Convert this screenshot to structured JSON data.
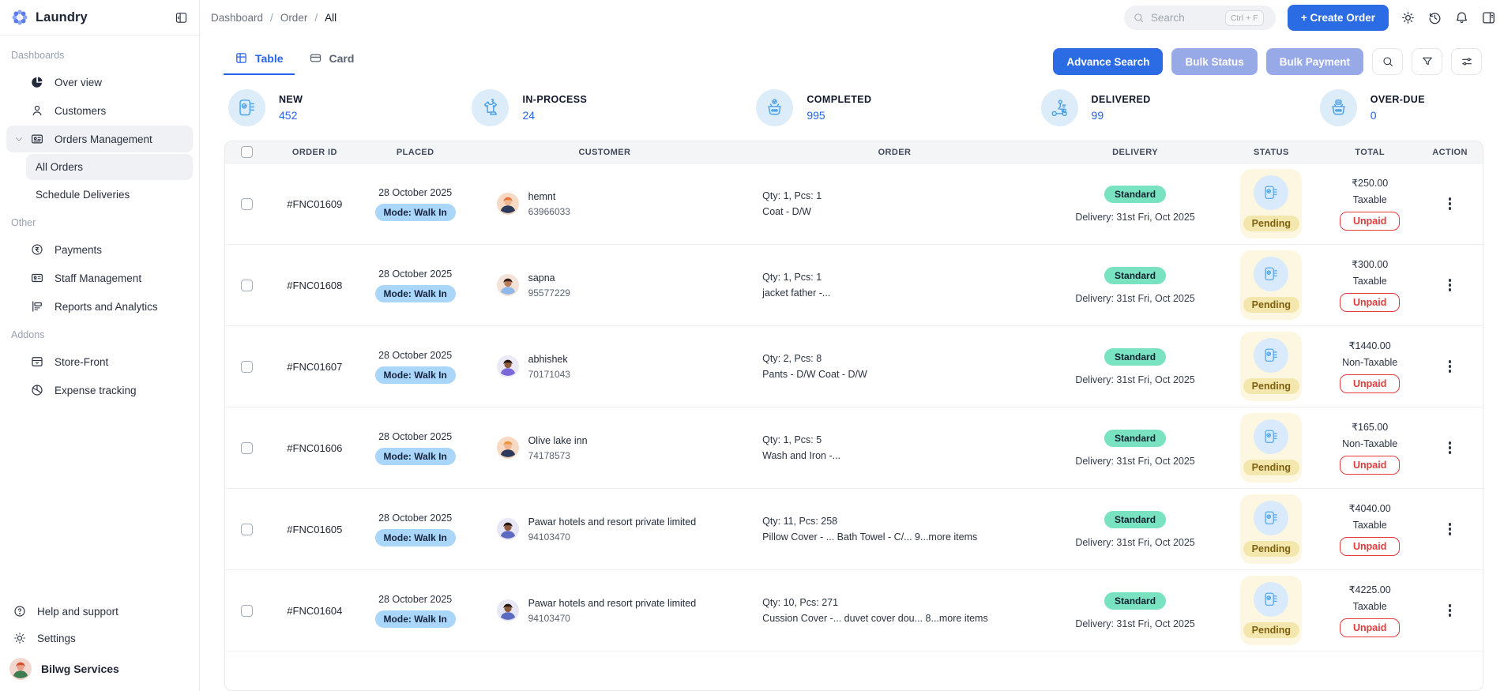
{
  "colors": {
    "accent": "#2b6be4",
    "disabled_button": "#98a9e8",
    "stat_value": "#2563eb",
    "standard_pill": "#79e2c1",
    "pending_bg": "#fdf7e2",
    "pending_pill": "#f4e7ae",
    "unpaid_red": "#e23b3b",
    "mode_pill": "#a9d6f9"
  },
  "app": {
    "name": "Laundry"
  },
  "breadcrumb": {
    "items": [
      "Dashboard",
      "Order"
    ],
    "current": "All"
  },
  "topbar": {
    "search_placeholder": "Search",
    "search_shortcut": "Ctrl + F",
    "create_order_label": "+ Create Order"
  },
  "sidebar": {
    "sections": {
      "dashboards": {
        "label": "Dashboards",
        "overview": "Over view",
        "customers": "Customers",
        "orders_management": "Orders Management",
        "all_orders": "All Orders",
        "schedule_deliveries": "Schedule Deliveries"
      },
      "other": {
        "label": "Other",
        "payments": "Payments",
        "staff_management": "Staff Management",
        "reports": "Reports and Analytics"
      },
      "addons": {
        "label": "Addons",
        "storefront": "Store-Front",
        "expense": "Expense tracking"
      }
    },
    "footer": {
      "help": "Help and support",
      "settings": "Settings",
      "user": "Bilwg Services"
    }
  },
  "toolbar": {
    "tab_table": "Table",
    "tab_card": "Card",
    "advance_search": "Advance Search",
    "bulk_status": "Bulk Status",
    "bulk_payment": "Bulk Payment"
  },
  "stats": [
    {
      "label": "NEW",
      "value": "452",
      "icon": "clipboard-check-icon"
    },
    {
      "label": "IN-PROCESS",
      "value": "24",
      "icon": "shirt-iron-icon"
    },
    {
      "label": "COMPLETED",
      "value": "995",
      "icon": "laundry-basket-icon"
    },
    {
      "label": "DELIVERED",
      "value": "99",
      "icon": "delivery-scooter-icon"
    },
    {
      "label": "OVER-DUE",
      "value": "0",
      "icon": "overdue-basket-icon"
    }
  ],
  "table": {
    "columns": {
      "order_id": "ORDER ID",
      "placed": "PLACED",
      "customer": "CUSTOMER",
      "order": "ORDER",
      "delivery": "DELIVERY",
      "status": "STATUS",
      "total": "TOTAL",
      "action": "ACTION"
    },
    "rows": [
      {
        "id": "#FNC01609",
        "date": "28 October 2025",
        "mode": "Mode: Walk In",
        "customer": {
          "name": "hemnt",
          "phone": "63966033",
          "avatar": {
            "bg": "#f7d9c4",
            "skin": "#f0b48e",
            "hair": "#e8733d",
            "shirt": "#2e3a5c"
          }
        },
        "order_qty": "Qty: 1, Pcs: 1",
        "order_items": "Coat - D/W",
        "delivery_type": "Standard",
        "delivery_date": "Delivery: 31st Fri, Oct 2025",
        "status": "Pending",
        "amount": "₹250.00",
        "tax": "Taxable",
        "payment": "Unpaid"
      },
      {
        "id": "#FNC01608",
        "date": "28 October 2025",
        "mode": "Mode: Walk In",
        "customer": {
          "name": "sapna",
          "phone": "95577229",
          "avatar": {
            "bg": "#f3e2d8",
            "skin": "#b97a56",
            "hair": "#33201c",
            "shirt": "#8fb8e8"
          }
        },
        "order_qty": "Qty: 1, Pcs: 1",
        "order_items": "jacket father -...",
        "delivery_type": "Standard",
        "delivery_date": "Delivery: 31st Fri, Oct 2025",
        "status": "Pending",
        "amount": "₹300.00",
        "tax": "Taxable",
        "payment": "Unpaid"
      },
      {
        "id": "#FNC01607",
        "date": "28 October 2025",
        "mode": "Mode: Walk In",
        "customer": {
          "name": "abhishek",
          "phone": "70171043",
          "avatar": {
            "bg": "#ece9f7",
            "skin": "#8d5a3b",
            "hair": "#26160f",
            "shirt": "#7b68d9"
          }
        },
        "order_qty": "Qty: 2, Pcs: 8",
        "order_items": "Pants - D/W Coat - D/W",
        "delivery_type": "Standard",
        "delivery_date": "Delivery: 31st Fri, Oct 2025",
        "status": "Pending",
        "amount": "₹1440.00",
        "tax": "Non-Taxable",
        "payment": "Unpaid"
      },
      {
        "id": "#FNC01606",
        "date": "28 October 2025",
        "mode": "Mode: Walk In",
        "customer": {
          "name": "Olive lake inn",
          "phone": "74178573",
          "avatar": {
            "bg": "#f7d9c4",
            "skin": "#f0b48e",
            "hair": "#e8973d",
            "shirt": "#2e3a5c"
          }
        },
        "order_qty": "Qty: 1, Pcs: 5",
        "order_items": "Wash and Iron -...",
        "delivery_type": "Standard",
        "delivery_date": "Delivery: 31st Fri, Oct 2025",
        "status": "Pending",
        "amount": "₹165.00",
        "tax": "Non-Taxable",
        "payment": "Unpaid"
      },
      {
        "id": "#FNC01605",
        "date": "28 October 2025",
        "mode": "Mode: Walk In",
        "customer": {
          "name": "Pawar hotels and resort private limited",
          "phone": "94103470",
          "avatar": {
            "bg": "#e7e6f5",
            "skin": "#8d5a3b",
            "hair": "#26160f",
            "shirt": "#5c6bc0"
          }
        },
        "order_qty": "Qty: 11, Pcs: 258",
        "order_items": "Pillow Cover - ... Bath Towel - C/... 9...more items",
        "delivery_type": "Standard",
        "delivery_date": "Delivery: 31st Fri, Oct 2025",
        "status": "Pending",
        "amount": "₹4040.00",
        "tax": "Taxable",
        "payment": "Unpaid"
      },
      {
        "id": "#FNC01604",
        "date": "28 October 2025",
        "mode": "Mode: Walk In",
        "customer": {
          "name": "Pawar hotels and resort private limited",
          "phone": "94103470",
          "avatar": {
            "bg": "#e7e6f5",
            "skin": "#8d5a3b",
            "hair": "#26160f",
            "shirt": "#5c6bc0"
          }
        },
        "order_qty": "Qty: 10, Pcs: 271",
        "order_items": "Cussion Cover -... duvet cover dou... 8...more items",
        "delivery_type": "Standard",
        "delivery_date": "Delivery: 31st Fri, Oct 2025",
        "status": "Pending",
        "amount": "₹4225.00",
        "tax": "Taxable",
        "payment": "Unpaid"
      }
    ]
  }
}
